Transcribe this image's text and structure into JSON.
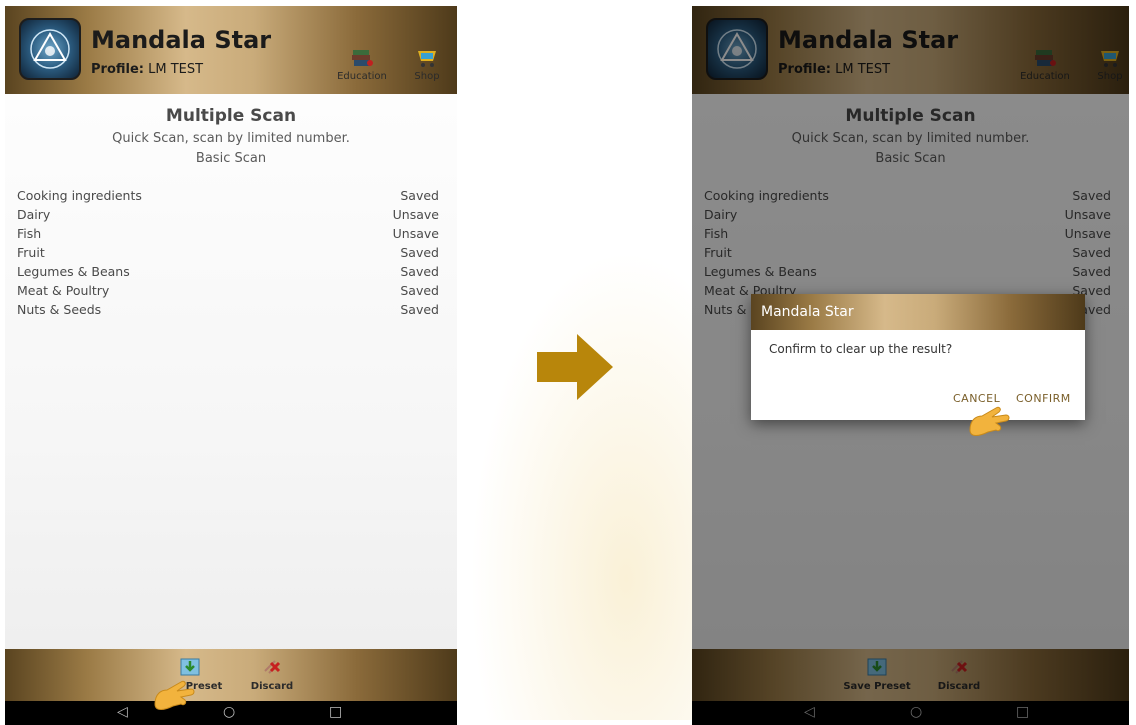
{
  "app": {
    "title": "Mandala Star",
    "profile_label": "Profile:",
    "profile_name": "LM TEST",
    "education_label": "Education",
    "shop_label": "Shop"
  },
  "content": {
    "title": "Multiple Scan",
    "subtitle": "Quick Scan, scan by limited number.",
    "subtitle2": "Basic Scan"
  },
  "results": [
    {
      "name": "Cooking ingredients",
      "status": "Saved"
    },
    {
      "name": "Dairy",
      "status": "Unsave"
    },
    {
      "name": "Fish",
      "status": "Unsave"
    },
    {
      "name": "Fruit",
      "status": "Saved"
    },
    {
      "name": "Legumes & Beans",
      "status": "Saved"
    },
    {
      "name": "Meat & Poultry",
      "status": "Saved"
    },
    {
      "name": "Nuts & Seeds",
      "status": "Saved"
    }
  ],
  "footer": {
    "save_preset_label": "Save Preset",
    "save_preset_label_partial": "Preset",
    "discard_label": "Discard"
  },
  "navbar": {
    "back": "◁",
    "home": "○",
    "recents": "□"
  },
  "dialog": {
    "title": "Mandala Star",
    "message": "Confirm to clear up the result?",
    "cancel_label": "CANCEL",
    "confirm_label": "CONFIRM"
  },
  "colors": {
    "accent_gold": "#9a7a45",
    "arrow": "#b8860b",
    "hand": "#f2b33d"
  },
  "icons": [
    "logo-icon",
    "education-books-icon",
    "shop-cart-icon",
    "save-preset-icon",
    "discard-icon",
    "arrow-right-icon",
    "pointing-hand-icon"
  ]
}
